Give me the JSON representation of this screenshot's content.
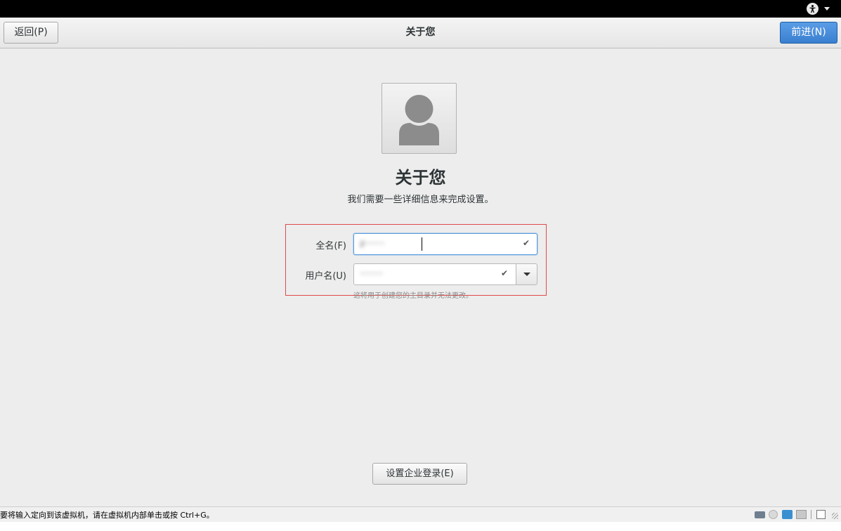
{
  "header": {
    "back_label": "返回(P)",
    "title": "关于您",
    "next_label": "前进(N)"
  },
  "main": {
    "heading": "关于您",
    "subtitle": "我们需要一些详细信息来完成设置。",
    "fullname_label": "全名(F)",
    "fullname_value": "z·······",
    "username_label": "用户名(U)",
    "username_value": "········",
    "hint": "这将用于创建您的主目录并无法更改。",
    "enterprise_label": "设置企业登录(E)"
  },
  "icons": {
    "check": "✔"
  },
  "statusbar": {
    "message": "要将输入定向到该虚拟机，请在虚拟机内部单击或按 Ctrl+G。"
  },
  "colors": {
    "accent": "#3a7fd0",
    "highlight_border": "#e04a4a"
  }
}
